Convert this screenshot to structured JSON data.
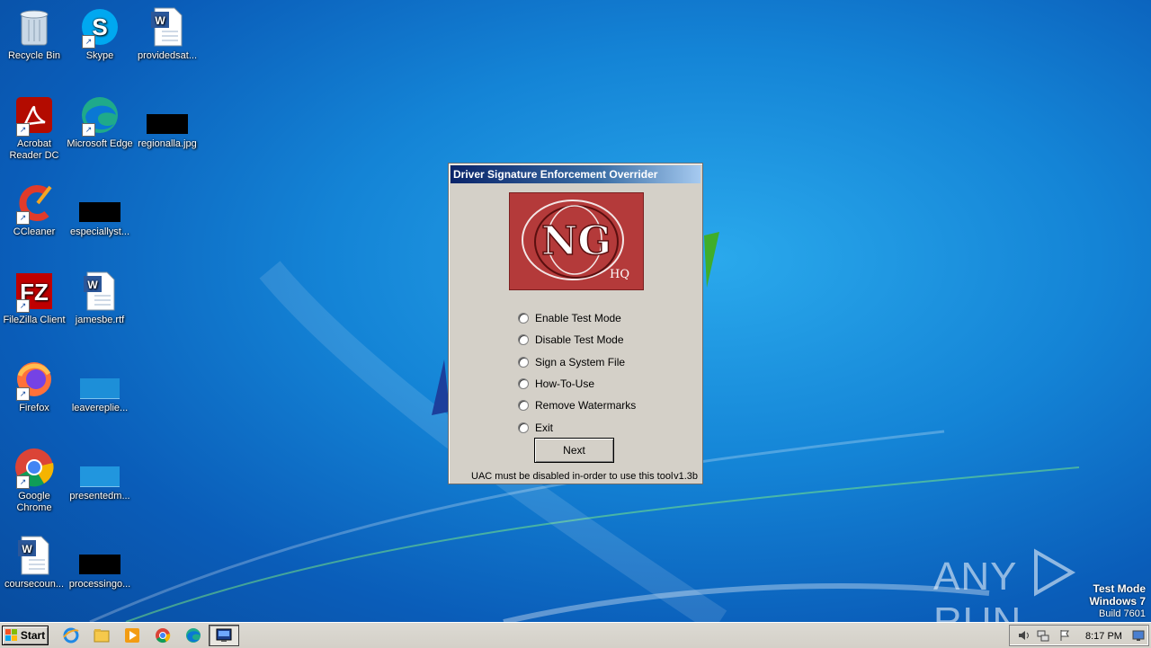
{
  "desktop": {
    "icons": [
      {
        "label": "Recycle Bin"
      },
      {
        "label": "Skype"
      },
      {
        "label": "providedsat..."
      },
      {
        "label": "Acrobat Reader DC"
      },
      {
        "label": "Microsoft Edge"
      },
      {
        "label": "regionalla.jpg"
      },
      {
        "label": "CCleaner"
      },
      {
        "label": "especiallyst..."
      },
      {
        "label": "FileZilla Client"
      },
      {
        "label": "jamesbe.rtf"
      },
      {
        "label": "Firefox"
      },
      {
        "label": "leavereplie..."
      },
      {
        "label": "Google Chrome"
      },
      {
        "label": "presentedm..."
      },
      {
        "label": "coursecoun..."
      },
      {
        "label": "processingo..."
      }
    ]
  },
  "dialog": {
    "title": "Driver Signature Enforcement Overrider",
    "logo_text": "NG",
    "logo_sub": "HQ",
    "options": [
      {
        "label": "Enable Test Mode"
      },
      {
        "label": "Disable Test Mode"
      },
      {
        "label": "Sign a System File"
      },
      {
        "label": "How-To-Use"
      },
      {
        "label": "Remove Watermarks"
      },
      {
        "label": "Exit"
      }
    ],
    "next_label": "Next",
    "footer_note": "UAC must be disabled in-order to use this tool",
    "version": "v1.3b"
  },
  "watermark": {
    "left": "ANY",
    "right": "RUN"
  },
  "os_status": {
    "line1": "Test Mode",
    "line2": "Windows 7",
    "line3": "Build 7601"
  },
  "taskbar": {
    "start_label": "Start",
    "clock": "8:17 PM"
  },
  "colors": {
    "dialog_bg": "#d4d0c8",
    "title_bar": "#0a246a",
    "logo_bg": "#b43a3a",
    "desktop": "#1484d6"
  }
}
